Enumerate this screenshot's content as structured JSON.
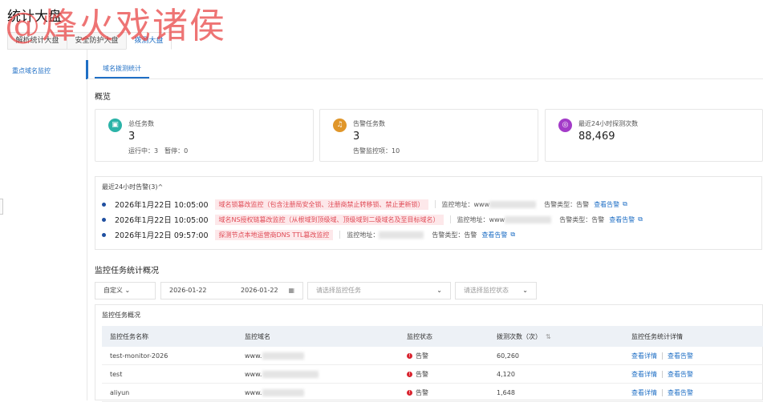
{
  "page_title": "统计大盘",
  "watermark": "@烽火戏诸侯",
  "tabs": [
    {
      "label": "解析统计大盘"
    },
    {
      "label": "安全防护大盘"
    },
    {
      "label": "拨测大盘",
      "active": true
    }
  ],
  "sidebar": {
    "items": [
      {
        "label": "重点域名监控"
      }
    ]
  },
  "subtab": "域名拨测统计",
  "overview": {
    "title": "概览",
    "cards": [
      {
        "label": "总任务数",
        "value": "3",
        "sub": "运行中：3　暂停：0",
        "icon": "task-icon",
        "color": "#2bb3a8"
      },
      {
        "label": "告警任务数",
        "value": "3",
        "sub": "告警监控项：10",
        "icon": "alarm-bell-icon",
        "color": "#e0962a"
      },
      {
        "label": "最近24小时探测次数",
        "value": "88,469",
        "icon": "probe-signal-icon",
        "color": "#a33bc8"
      }
    ]
  },
  "alerts": {
    "header": "最近24小时告警(3)^",
    "addr_label": "监控地址：",
    "type_label": "告警类型：",
    "type_value": "告警",
    "link": "查看告警",
    "items": [
      {
        "time": "2026年1月22日 10:05:00",
        "tag": "域名锁篡改监控（包含注册局安全锁、注册商禁止转移锁、禁止更新锁）",
        "addr": "www"
      },
      {
        "time": "2026年1月22日 10:05:00",
        "tag": "域名NS授权链篡改监控（从根域到顶级域、顶级域到二级域名及至目标域名）",
        "addr": "www"
      },
      {
        "time": "2026年1月22日 09:57:00",
        "tag": "探测节点本地运营商DNS TTL篡改监控",
        "addr": ""
      }
    ]
  },
  "stats": {
    "title": "监控任务统计概况",
    "filters": {
      "range": "自定义",
      "start": "2026-01-22",
      "end": "2026-01-22",
      "task_placeholder": "请选择监控任务",
      "status_placeholder": "请选择监控状态"
    },
    "table_title": "监控任务概况",
    "columns": [
      "监控任务名称",
      "监控域名",
      "监控状态",
      "拨测次数（次）",
      "监控任务统计详情"
    ],
    "rows": [
      {
        "name": "test-monitor-2026",
        "domain": "www.",
        "status": "告警",
        "count": "60,260"
      },
      {
        "name": "test",
        "domain": "www.",
        "status": "告警",
        "count": "4,120"
      },
      {
        "name": "aliyun",
        "domain": "www.",
        "status": "告警",
        "count": "1,648"
      }
    ],
    "detail_link": "查看详情",
    "alarm_link": "查看告警"
  },
  "colors": {
    "accent": "#1f6fc5",
    "alarm": "#d9232e"
  }
}
